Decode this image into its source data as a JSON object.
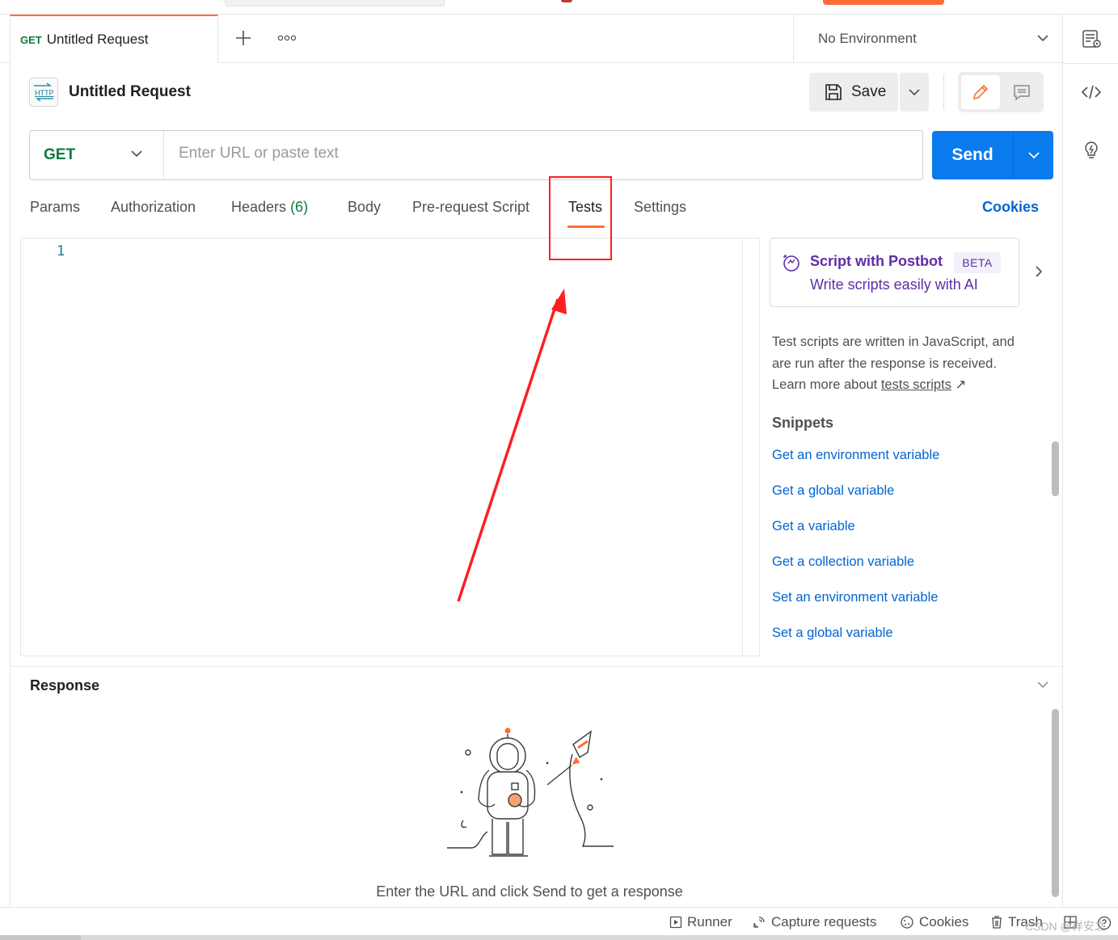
{
  "tab": {
    "method": "GET",
    "name": "Untitled Request"
  },
  "environment": {
    "label": "No Environment"
  },
  "request": {
    "title": "Untitled Request"
  },
  "toolbar": {
    "save_label": "Save"
  },
  "url_bar": {
    "method": "GET",
    "placeholder": "Enter URL or paste text",
    "value": ""
  },
  "send": {
    "label": "Send"
  },
  "request_tabs": [
    {
      "label": "Params"
    },
    {
      "label": "Authorization"
    },
    {
      "label": "Headers",
      "count": "(6)"
    },
    {
      "label": "Body"
    },
    {
      "label": "Pre-request Script"
    },
    {
      "label": "Tests",
      "active": true
    },
    {
      "label": "Settings"
    }
  ],
  "cookies_link": "Cookies",
  "editor": {
    "line_number": "1"
  },
  "postbot": {
    "title": "Script with Postbot",
    "badge": "BETA",
    "subtitle": "Write scripts easily with AI"
  },
  "description": {
    "line1": "Test scripts are written in JavaScript, and",
    "line2": "are run after the response is received.",
    "line3_prefix": "Learn more about ",
    "line3_link": "tests scripts",
    "line3_suffix": " ↗"
  },
  "snippets": {
    "heading": "Snippets",
    "items": [
      "Get an environment variable",
      "Get a global variable",
      "Get a variable",
      "Get a collection variable",
      "Set an environment variable",
      "Set a global variable"
    ]
  },
  "response": {
    "title": "Response",
    "empty_message": "Enter the URL and click Send to get a response"
  },
  "footer": {
    "runner": "Runner",
    "capture": "Capture requests",
    "cookies": "Cookies",
    "trash": "Trash"
  },
  "watermark": "CSDN @祥安之",
  "colors": {
    "accent": "#ff6c37",
    "send": "#097bed",
    "method_get": "#0b7a3e",
    "link": "#0265d2",
    "postbot": "#5d2ea6",
    "annotation": "#ff1e1e"
  }
}
